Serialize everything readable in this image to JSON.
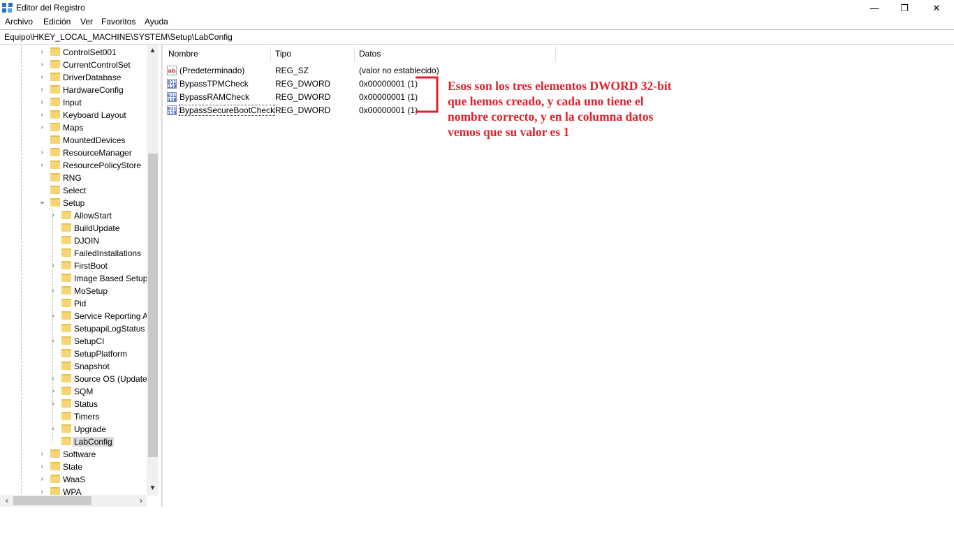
{
  "window": {
    "title": "Editor del Registro",
    "minimize_glyph": "—",
    "maximize_glyph": "❐",
    "close_glyph": "✕"
  },
  "menu": [
    "Archivo",
    "Edición",
    "Ver",
    "Favoritos",
    "Ayuda"
  ],
  "address": "Equipo\\HKEY_LOCAL_MACHINE\\SYSTEM\\Setup\\LabConfig",
  "tree": [
    {
      "label": "ControlSet001",
      "level": 1,
      "expand": "collapsed"
    },
    {
      "label": "CurrentControlSet",
      "level": 1,
      "expand": "collapsed"
    },
    {
      "label": "DriverDatabase",
      "level": 1,
      "expand": "collapsed"
    },
    {
      "label": "HardwareConfig",
      "level": 1,
      "expand": "collapsed"
    },
    {
      "label": "Input",
      "level": 1,
      "expand": "collapsed"
    },
    {
      "label": "Keyboard Layout",
      "level": 1,
      "expand": "collapsed"
    },
    {
      "label": "Maps",
      "level": 1,
      "expand": "collapsed"
    },
    {
      "label": "MountedDevices",
      "level": 1,
      "expand": "none"
    },
    {
      "label": "ResourceManager",
      "level": 1,
      "expand": "collapsed"
    },
    {
      "label": "ResourcePolicyStore",
      "level": 1,
      "expand": "collapsed"
    },
    {
      "label": "RNG",
      "level": 1,
      "expand": "none"
    },
    {
      "label": "Select",
      "level": 1,
      "expand": "none"
    },
    {
      "label": "Setup",
      "level": 1,
      "expand": "expanded"
    },
    {
      "label": "AllowStart",
      "level": 2,
      "expand": "collapsed"
    },
    {
      "label": "BuildUpdate",
      "level": 2,
      "expand": "none"
    },
    {
      "label": "DJOIN",
      "level": 2,
      "expand": "none"
    },
    {
      "label": "FailedInstallations",
      "level": 2,
      "expand": "none"
    },
    {
      "label": "FirstBoot",
      "level": 2,
      "expand": "collapsed"
    },
    {
      "label": "Image Based Setup",
      "level": 2,
      "expand": "none"
    },
    {
      "label": "MoSetup",
      "level": 2,
      "expand": "collapsed"
    },
    {
      "label": "Pid",
      "level": 2,
      "expand": "none"
    },
    {
      "label": "Service Reporting A",
      "level": 2,
      "expand": "collapsed"
    },
    {
      "label": "SetupapiLogStatus",
      "level": 2,
      "expand": "none"
    },
    {
      "label": "SetupCI",
      "level": 2,
      "expand": "collapsed"
    },
    {
      "label": "SetupPlatform",
      "level": 2,
      "expand": "none"
    },
    {
      "label": "Snapshot",
      "level": 2,
      "expand": "none"
    },
    {
      "label": "Source OS (Updatec",
      "level": 2,
      "expand": "collapsed"
    },
    {
      "label": "SQM",
      "level": 2,
      "expand": "collapsed"
    },
    {
      "label": "Status",
      "level": 2,
      "expand": "collapsed"
    },
    {
      "label": "Timers",
      "level": 2,
      "expand": "none"
    },
    {
      "label": "Upgrade",
      "level": 2,
      "expand": "collapsed"
    },
    {
      "label": "LabConfig",
      "level": 2,
      "expand": "none",
      "selected": true
    },
    {
      "label": "Software",
      "level": 1,
      "expand": "collapsed"
    },
    {
      "label": "State",
      "level": 1,
      "expand": "collapsed"
    },
    {
      "label": "WaaS",
      "level": 1,
      "expand": "collapsed"
    },
    {
      "label": "WPA",
      "level": 1,
      "expand": "collapsed"
    }
  ],
  "list": {
    "columns": [
      "Nombre",
      "Tipo",
      "Datos"
    ],
    "rows": [
      {
        "icon": "string-value-icon",
        "icon_text": "ab",
        "name": "(Predeterminado)",
        "type": "REG_SZ",
        "data": "(valor no establecido)"
      },
      {
        "icon": "dword-value-icon",
        "icon_text": "011 110",
        "name": "BypassTPMCheck",
        "type": "REG_DWORD",
        "data": "0x00000001 (1)"
      },
      {
        "icon": "dword-value-icon",
        "icon_text": "011 110",
        "name": "BypassRAMCheck",
        "type": "REG_DWORD",
        "data": "0x00000001 (1)"
      },
      {
        "icon": "dword-value-icon",
        "icon_text": "011 110",
        "name": "BypassSecureBootCheck",
        "type": "REG_DWORD",
        "data": "0x00000001 (1)",
        "focused": true
      }
    ]
  },
  "annotation": {
    "text": "Esos son los tres elementos DWORD 32-bit que hemos creado, y cada uno tiene el nombre correcto, y en la columna datos vemos que su valor es 1",
    "color": "#e0202a"
  },
  "scroll": {
    "up_glyph": "▲",
    "down_glyph": "▼",
    "left_glyph": "‹",
    "right_glyph": "›"
  }
}
